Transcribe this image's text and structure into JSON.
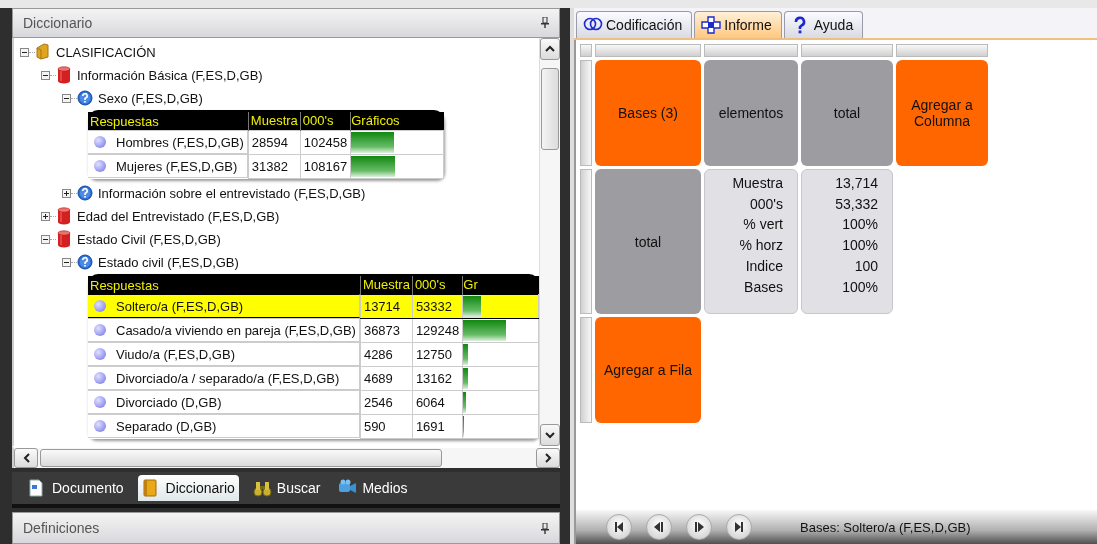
{
  "dictionary_panel": {
    "title": "Diccionario",
    "tree": [
      {
        "label": "CLASIFICACIÓN",
        "kind": "folder",
        "expanded": true,
        "children": [
          {
            "label": "Información Básica (F,ES,D,GB)",
            "kind": "database",
            "expanded": true,
            "children": [
              {
                "label": "Sexo (F,ES,D,GB)",
                "kind": "question",
                "expanded": true,
                "table": {
                  "columns": [
                    "Respuestas",
                    "Muestra",
                    "000's",
                    "Gráficos"
                  ],
                  "rows": [
                    {
                      "cells": [
                        "Hombres (F,ES,D,GB)",
                        "28594",
                        "102458"
                      ],
                      "level": 0.46,
                      "selected": false
                    },
                    {
                      "cells": [
                        "Mujeres (F,ES,D,GB)",
                        "31382",
                        "108167"
                      ],
                      "level": 0.48,
                      "selected": false
                    }
                  ]
                }
              },
              {
                "label": "Información sobre el entrevistado (F,ES,D,GB)",
                "kind": "question",
                "expanded": false
              }
            ]
          },
          {
            "label": "Edad del Entrevistado (F,ES,D,GB)",
            "kind": "database",
            "expanded": false
          },
          {
            "label": "Estado Civil (F,ES,D,GB)",
            "kind": "database",
            "expanded": true,
            "children": [
              {
                "label": "Estado civil (F,ES,D,GB)",
                "kind": "question",
                "expanded": true,
                "table": {
                  "columns": [
                    "Respuestas",
                    "Muestra",
                    "000's",
                    "Gr"
                  ],
                  "rows": [
                    {
                      "cells": [
                        "Soltero/a (F,ES,D,GB)",
                        "13714",
                        "53332"
                      ],
                      "level": 0.24,
                      "selected": true
                    },
                    {
                      "cells": [
                        "Casado/a viviendo en pareja (F,ES,D,GB)",
                        "36873",
                        "129248"
                      ],
                      "level": 0.57,
                      "selected": false
                    },
                    {
                      "cells": [
                        "Viudo/a (F,ES,D,GB)",
                        "4286",
                        "12750"
                      ],
                      "level": 0.06,
                      "selected": false
                    },
                    {
                      "cells": [
                        "Divorciado/a / separado/a (F,ES,D,GB)",
                        "4689",
                        "13162"
                      ],
                      "level": 0.06,
                      "selected": false
                    },
                    {
                      "cells": [
                        "Divorciado (D,GB)",
                        "2546",
                        "6064"
                      ],
                      "level": 0.03,
                      "selected": false
                    },
                    {
                      "cells": [
                        "Separado (D,GB)",
                        "590",
                        "1691"
                      ],
                      "level": 0.01,
                      "selected": false
                    }
                  ]
                }
              }
            ]
          }
        ]
      }
    ]
  },
  "panel_tabs": [
    {
      "label": "Documento",
      "selected": false
    },
    {
      "label": "Diccionario",
      "selected": true
    },
    {
      "label": "Buscar",
      "selected": false
    },
    {
      "label": "Medios",
      "selected": false
    }
  ],
  "definitions_panel": {
    "title": "Definiciones"
  },
  "report_tabs": [
    {
      "label": "Codificación",
      "selected": false
    },
    {
      "label": "Informe",
      "selected": true
    },
    {
      "label": "Ayuda",
      "selected": false
    }
  ],
  "report": {
    "rows": [
      {
        "cells": [
          {
            "kind": "action",
            "text": "Bases (3)"
          },
          {
            "kind": "heading",
            "text": "elementos"
          },
          {
            "kind": "heading",
            "text": "total"
          },
          {
            "kind": "action",
            "text": "Agregar a Columna"
          }
        ]
      },
      {
        "cells": [
          {
            "kind": "heading",
            "text": "total"
          },
          {
            "kind": "stats",
            "lines": [
              "Muestra",
              "000's",
              "% vert",
              "% horz",
              "Indice",
              "Bases"
            ]
          },
          {
            "kind": "stats",
            "lines": [
              "13,714",
              "53,332",
              "100%",
              "100%",
              "100",
              "100%"
            ]
          }
        ]
      },
      {
        "cells": [
          {
            "kind": "action",
            "text": "Agregar a Fila"
          }
        ]
      }
    ]
  },
  "status_bar": {
    "text": "Bases: Soltero/a (F,ES,D,GB)"
  }
}
